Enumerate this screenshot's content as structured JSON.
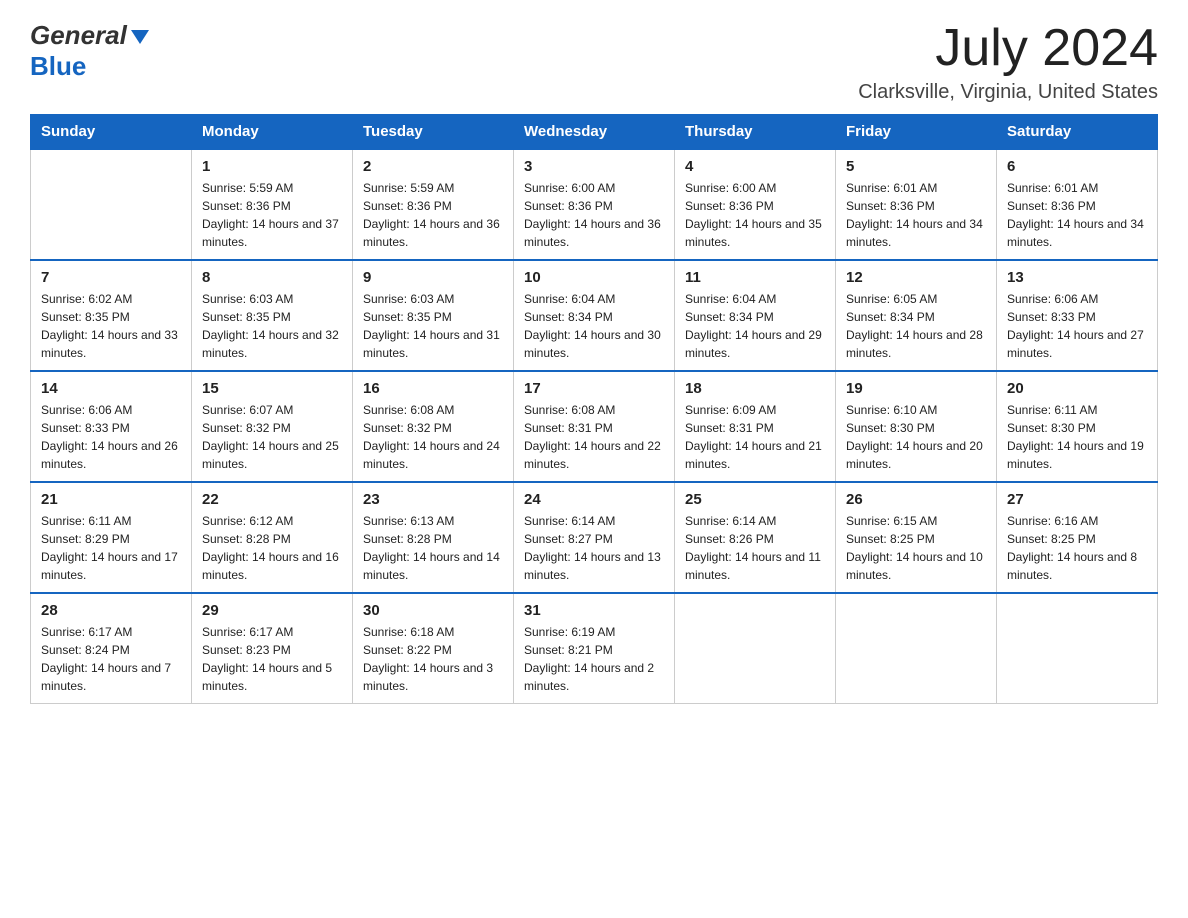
{
  "header": {
    "title": "July 2024",
    "subtitle": "Clarksville, Virginia, United States",
    "logo_general": "General",
    "logo_blue": "Blue"
  },
  "weekdays": [
    "Sunday",
    "Monday",
    "Tuesday",
    "Wednesday",
    "Thursday",
    "Friday",
    "Saturday"
  ],
  "weeks": [
    [
      {
        "day": "",
        "sunrise": "",
        "sunset": "",
        "daylight": ""
      },
      {
        "day": "1",
        "sunrise": "Sunrise: 5:59 AM",
        "sunset": "Sunset: 8:36 PM",
        "daylight": "Daylight: 14 hours and 37 minutes."
      },
      {
        "day": "2",
        "sunrise": "Sunrise: 5:59 AM",
        "sunset": "Sunset: 8:36 PM",
        "daylight": "Daylight: 14 hours and 36 minutes."
      },
      {
        "day": "3",
        "sunrise": "Sunrise: 6:00 AM",
        "sunset": "Sunset: 8:36 PM",
        "daylight": "Daylight: 14 hours and 36 minutes."
      },
      {
        "day": "4",
        "sunrise": "Sunrise: 6:00 AM",
        "sunset": "Sunset: 8:36 PM",
        "daylight": "Daylight: 14 hours and 35 minutes."
      },
      {
        "day": "5",
        "sunrise": "Sunrise: 6:01 AM",
        "sunset": "Sunset: 8:36 PM",
        "daylight": "Daylight: 14 hours and 34 minutes."
      },
      {
        "day": "6",
        "sunrise": "Sunrise: 6:01 AM",
        "sunset": "Sunset: 8:36 PM",
        "daylight": "Daylight: 14 hours and 34 minutes."
      }
    ],
    [
      {
        "day": "7",
        "sunrise": "Sunrise: 6:02 AM",
        "sunset": "Sunset: 8:35 PM",
        "daylight": "Daylight: 14 hours and 33 minutes."
      },
      {
        "day": "8",
        "sunrise": "Sunrise: 6:03 AM",
        "sunset": "Sunset: 8:35 PM",
        "daylight": "Daylight: 14 hours and 32 minutes."
      },
      {
        "day": "9",
        "sunrise": "Sunrise: 6:03 AM",
        "sunset": "Sunset: 8:35 PM",
        "daylight": "Daylight: 14 hours and 31 minutes."
      },
      {
        "day": "10",
        "sunrise": "Sunrise: 6:04 AM",
        "sunset": "Sunset: 8:34 PM",
        "daylight": "Daylight: 14 hours and 30 minutes."
      },
      {
        "day": "11",
        "sunrise": "Sunrise: 6:04 AM",
        "sunset": "Sunset: 8:34 PM",
        "daylight": "Daylight: 14 hours and 29 minutes."
      },
      {
        "day": "12",
        "sunrise": "Sunrise: 6:05 AM",
        "sunset": "Sunset: 8:34 PM",
        "daylight": "Daylight: 14 hours and 28 minutes."
      },
      {
        "day": "13",
        "sunrise": "Sunrise: 6:06 AM",
        "sunset": "Sunset: 8:33 PM",
        "daylight": "Daylight: 14 hours and 27 minutes."
      }
    ],
    [
      {
        "day": "14",
        "sunrise": "Sunrise: 6:06 AM",
        "sunset": "Sunset: 8:33 PM",
        "daylight": "Daylight: 14 hours and 26 minutes."
      },
      {
        "day": "15",
        "sunrise": "Sunrise: 6:07 AM",
        "sunset": "Sunset: 8:32 PM",
        "daylight": "Daylight: 14 hours and 25 minutes."
      },
      {
        "day": "16",
        "sunrise": "Sunrise: 6:08 AM",
        "sunset": "Sunset: 8:32 PM",
        "daylight": "Daylight: 14 hours and 24 minutes."
      },
      {
        "day": "17",
        "sunrise": "Sunrise: 6:08 AM",
        "sunset": "Sunset: 8:31 PM",
        "daylight": "Daylight: 14 hours and 22 minutes."
      },
      {
        "day": "18",
        "sunrise": "Sunrise: 6:09 AM",
        "sunset": "Sunset: 8:31 PM",
        "daylight": "Daylight: 14 hours and 21 minutes."
      },
      {
        "day": "19",
        "sunrise": "Sunrise: 6:10 AM",
        "sunset": "Sunset: 8:30 PM",
        "daylight": "Daylight: 14 hours and 20 minutes."
      },
      {
        "day": "20",
        "sunrise": "Sunrise: 6:11 AM",
        "sunset": "Sunset: 8:30 PM",
        "daylight": "Daylight: 14 hours and 19 minutes."
      }
    ],
    [
      {
        "day": "21",
        "sunrise": "Sunrise: 6:11 AM",
        "sunset": "Sunset: 8:29 PM",
        "daylight": "Daylight: 14 hours and 17 minutes."
      },
      {
        "day": "22",
        "sunrise": "Sunrise: 6:12 AM",
        "sunset": "Sunset: 8:28 PM",
        "daylight": "Daylight: 14 hours and 16 minutes."
      },
      {
        "day": "23",
        "sunrise": "Sunrise: 6:13 AM",
        "sunset": "Sunset: 8:28 PM",
        "daylight": "Daylight: 14 hours and 14 minutes."
      },
      {
        "day": "24",
        "sunrise": "Sunrise: 6:14 AM",
        "sunset": "Sunset: 8:27 PM",
        "daylight": "Daylight: 14 hours and 13 minutes."
      },
      {
        "day": "25",
        "sunrise": "Sunrise: 6:14 AM",
        "sunset": "Sunset: 8:26 PM",
        "daylight": "Daylight: 14 hours and 11 minutes."
      },
      {
        "day": "26",
        "sunrise": "Sunrise: 6:15 AM",
        "sunset": "Sunset: 8:25 PM",
        "daylight": "Daylight: 14 hours and 10 minutes."
      },
      {
        "day": "27",
        "sunrise": "Sunrise: 6:16 AM",
        "sunset": "Sunset: 8:25 PM",
        "daylight": "Daylight: 14 hours and 8 minutes."
      }
    ],
    [
      {
        "day": "28",
        "sunrise": "Sunrise: 6:17 AM",
        "sunset": "Sunset: 8:24 PM",
        "daylight": "Daylight: 14 hours and 7 minutes."
      },
      {
        "day": "29",
        "sunrise": "Sunrise: 6:17 AM",
        "sunset": "Sunset: 8:23 PM",
        "daylight": "Daylight: 14 hours and 5 minutes."
      },
      {
        "day": "30",
        "sunrise": "Sunrise: 6:18 AM",
        "sunset": "Sunset: 8:22 PM",
        "daylight": "Daylight: 14 hours and 3 minutes."
      },
      {
        "day": "31",
        "sunrise": "Sunrise: 6:19 AM",
        "sunset": "Sunset: 8:21 PM",
        "daylight": "Daylight: 14 hours and 2 minutes."
      },
      {
        "day": "",
        "sunrise": "",
        "sunset": "",
        "daylight": ""
      },
      {
        "day": "",
        "sunrise": "",
        "sunset": "",
        "daylight": ""
      },
      {
        "day": "",
        "sunrise": "",
        "sunset": "",
        "daylight": ""
      }
    ]
  ]
}
